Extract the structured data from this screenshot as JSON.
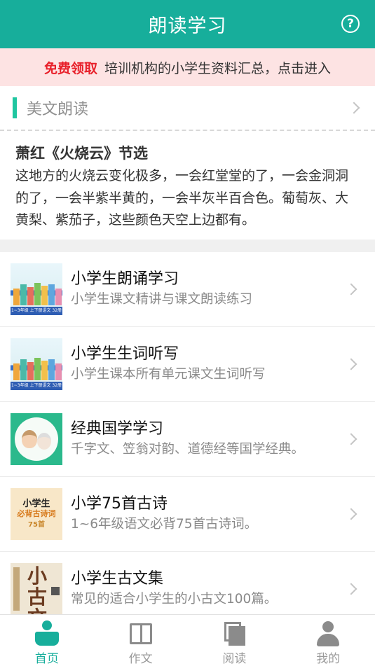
{
  "header": {
    "title": "朗读学习",
    "help_icon": "question-circle-icon",
    "help_glyph": "?"
  },
  "promo": {
    "highlight": "免费领取",
    "text": "培训机构的小学生资料汇总，点击进入"
  },
  "section": {
    "label": "美文朗读"
  },
  "excerpt": {
    "title": "萧红《火烧云》节选",
    "body": "这地方的火烧云变化极多，一会红堂堂的了，一会金洞洞的了，一会半紫半黄的，一会半灰半百合色。葡萄灰、大黄梨、紫茄子，这些颜色天空上边都有。"
  },
  "list": [
    {
      "title": "小学生朗诵学习",
      "subtitle": "小学生课文精讲与课文朗读练习",
      "thumb_caption": "1~3年级 上下册语文 32册"
    },
    {
      "title": "小学生生词听写",
      "subtitle": "小学生课本所有单元课文生词听写",
      "thumb_caption": "1~3年级 上下册语文 32册"
    },
    {
      "title": "经典国学学习",
      "subtitle": "千字文、笠翁对韵、道德经等国学经典。"
    },
    {
      "title": "小学75首古诗",
      "subtitle": "1~6年级语文必背75首古诗词。",
      "thumb_lines": [
        "小学生",
        "必背古诗词",
        "75首"
      ]
    },
    {
      "title": "小学生古文集",
      "subtitle": "常见的适合小学生的小古文100篇。",
      "thumb_glyph": "小古文"
    }
  ],
  "tabs": [
    {
      "label": "首页",
      "icon": "home-reader-icon",
      "active": true
    },
    {
      "label": "作文",
      "icon": "open-book-icon",
      "active": false
    },
    {
      "label": "阅读",
      "icon": "pages-icon",
      "active": false
    },
    {
      "label": "我的",
      "icon": "user-icon",
      "active": false
    }
  ],
  "colors": {
    "primary": "#17ae9b",
    "promo_bg": "#fde3e3",
    "promo_highlight": "#e8202a",
    "section_bar": "#1fc6a0"
  }
}
